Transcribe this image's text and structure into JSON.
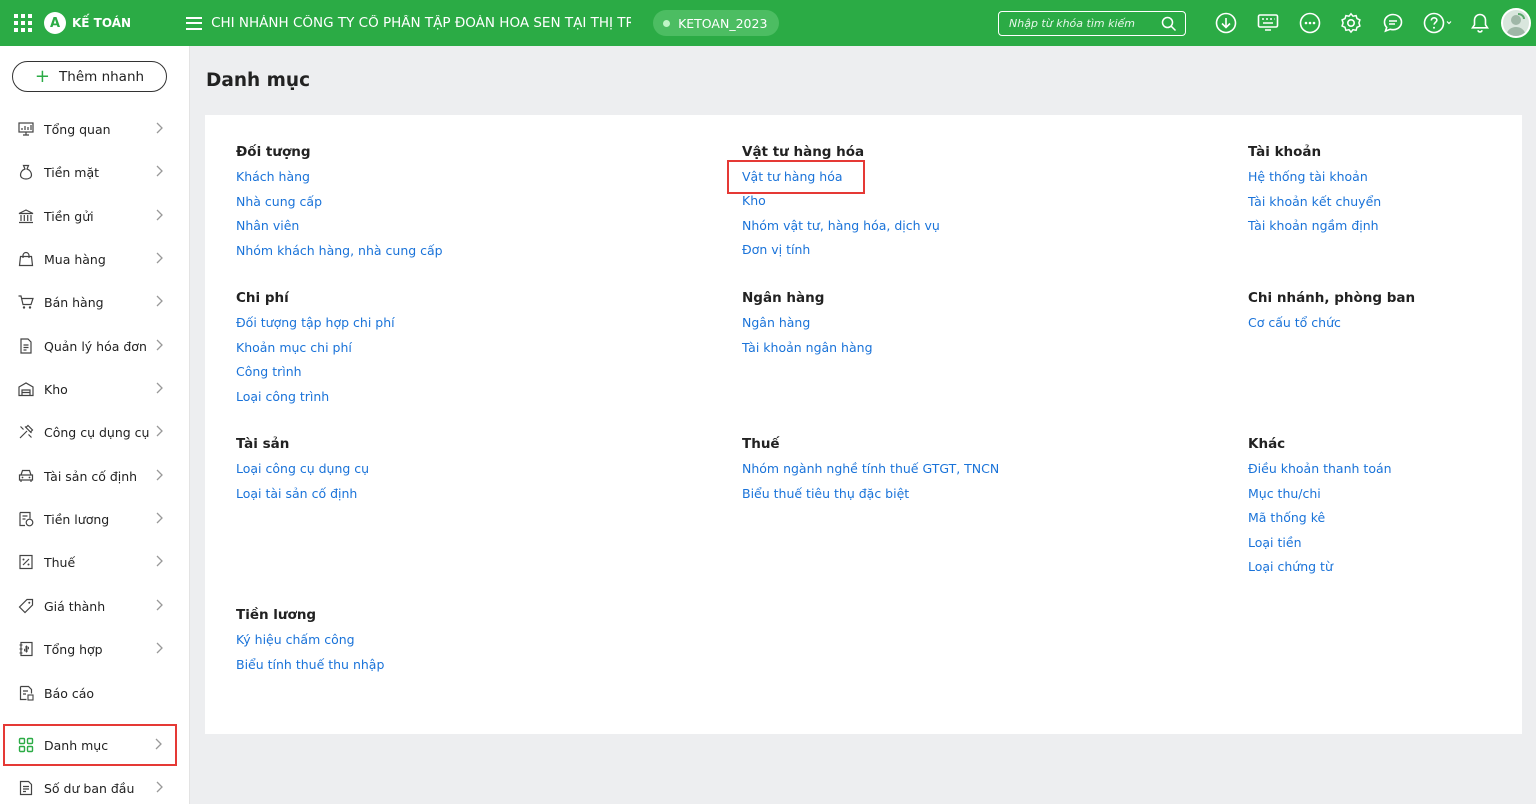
{
  "app": {
    "logo_letter": "A",
    "logo_text": "KẾ TOÁN",
    "company": "CHI NHÁNH CÔNG TY CỔ PHẦN TẬP ĐOÀN HOA SEN TẠI THỊ TRẤ...",
    "database": "KETOAN_2023",
    "search_placeholder": "Nhập từ khóa tìm kiếm",
    "brand_color": "#2bab45"
  },
  "sidebar": {
    "quick_add": "Thêm nhanh",
    "items": [
      {
        "label": "Tổng quan",
        "icon": "monitor-chart-icon"
      },
      {
        "label": "Tiền mặt",
        "icon": "money-bag-icon"
      },
      {
        "label": "Tiền gửi",
        "icon": "bank-icon"
      },
      {
        "label": "Mua hàng",
        "icon": "shopping-bag-icon"
      },
      {
        "label": "Bán hàng",
        "icon": "cart-icon"
      },
      {
        "label": "Quản lý hóa đơn",
        "icon": "invoice-icon"
      },
      {
        "label": "Kho",
        "icon": "warehouse-icon"
      },
      {
        "label": "Công cụ dụng cụ",
        "icon": "tools-icon"
      },
      {
        "label": "Tài sản cố định",
        "icon": "car-icon"
      },
      {
        "label": "Tiền lương",
        "icon": "salary-icon"
      },
      {
        "label": "Thuế",
        "icon": "percent-doc-icon"
      },
      {
        "label": "Giá thành",
        "icon": "price-tag-icon"
      },
      {
        "label": "Tổng hợp",
        "icon": "ledger-icon"
      },
      {
        "label": "Báo cáo",
        "icon": "report-icon"
      },
      {
        "label": "Danh mục",
        "icon": "grid-icon"
      },
      {
        "label": "Số dư ban đầu",
        "icon": "balance-doc-icon"
      }
    ]
  },
  "main": {
    "title": "Danh mục",
    "groups": {
      "doi_tuong": {
        "title": "Đối tượng",
        "links": [
          "Khách hàng",
          "Nhà cung cấp",
          "Nhân viên",
          "Nhóm khách hàng, nhà cung cấp"
        ]
      },
      "vat_tu": {
        "title": "Vật tư hàng hóa",
        "links": [
          "Vật tư hàng hóa",
          "Kho",
          "Nhóm vật tư, hàng hóa, dịch vụ",
          "Đơn vị tính"
        ]
      },
      "tai_khoan": {
        "title": "Tài khoản",
        "links": [
          "Hệ thống tài khoản",
          "Tài khoản kết chuyển",
          "Tài khoản ngầm định"
        ]
      },
      "chi_phi": {
        "title": "Chi phí",
        "links": [
          "Đối tượng tập hợp chi phí",
          "Khoản mục chi phí",
          "Công trình",
          "Loại công trình"
        ]
      },
      "ngan_hang": {
        "title": "Ngân hàng",
        "links": [
          "Ngân hàng",
          "Tài khoản ngân hàng"
        ]
      },
      "chi_nhanh": {
        "title": "Chi nhánh, phòng ban",
        "links": [
          "Cơ cấu tổ chức"
        ]
      },
      "tai_san": {
        "title": "Tài sản",
        "links": [
          "Loại công cụ dụng cụ",
          "Loại tài sản cố định"
        ]
      },
      "thue": {
        "title": "Thuế",
        "links": [
          "Nhóm ngành nghề tính thuế GTGT, TNCN",
          "Biểu thuế tiêu thụ đặc biệt"
        ]
      },
      "khac": {
        "title": "Khác",
        "links": [
          "Điều khoản thanh toán",
          "Mục thu/chi",
          "Mã thống kê",
          "Loại tiền",
          "Loại chứng từ"
        ]
      },
      "tien_luong": {
        "title": "Tiền lương",
        "links": [
          "Ký hiệu chấm công",
          "Biểu tính thuế thu nhập"
        ]
      }
    }
  }
}
